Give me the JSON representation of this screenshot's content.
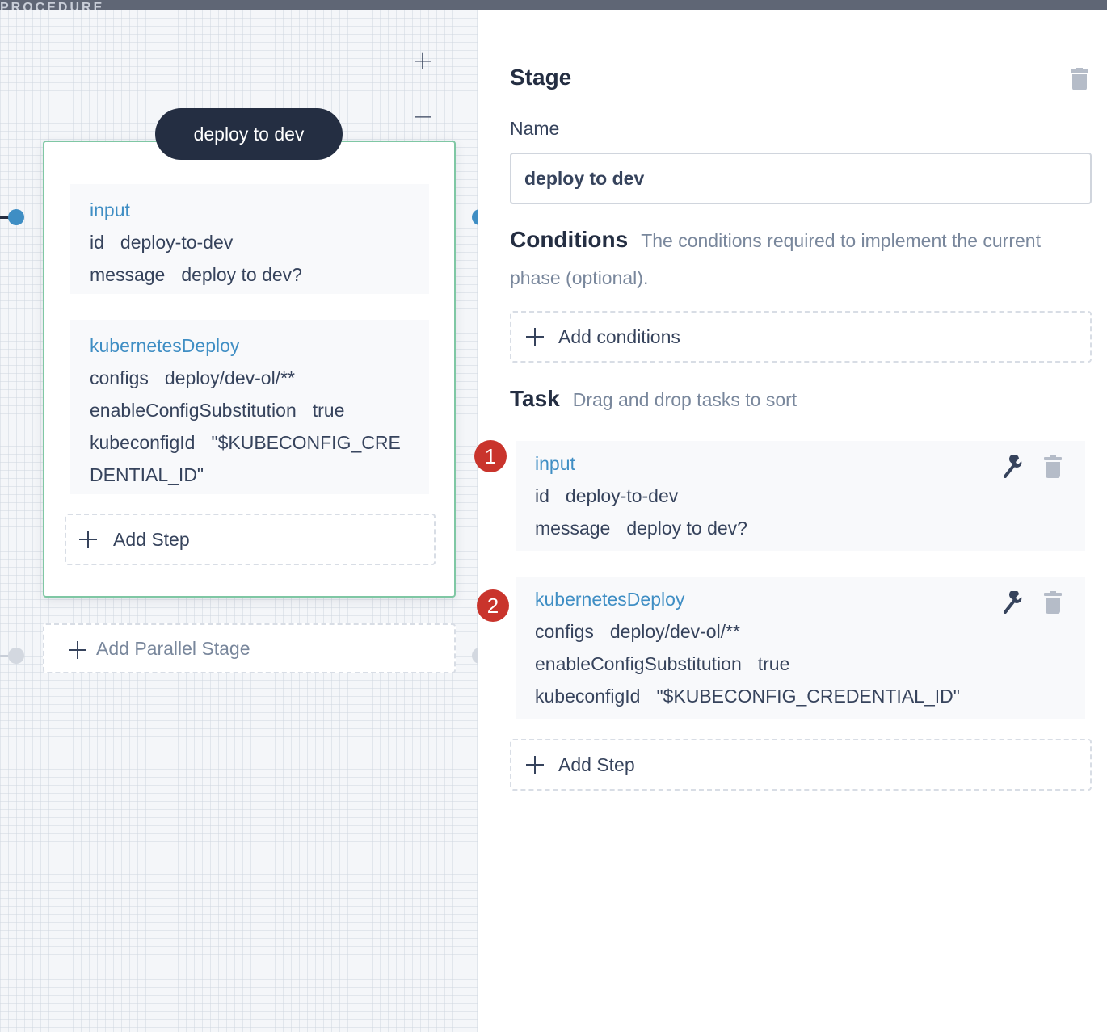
{
  "topbar": {
    "partial_text": "PROCEDURE"
  },
  "canvas": {
    "zoom_in": "+",
    "zoom_out": "−",
    "stage": {
      "title": "deploy to dev",
      "steps": [
        {
          "name": "input",
          "rows": [
            {
              "key": "id",
              "value": "deploy-to-dev"
            },
            {
              "key": "message",
              "value": "deploy to dev?"
            }
          ]
        },
        {
          "name": "kubernetesDeploy",
          "rows": [
            {
              "key": "configs",
              "value": "deploy/dev-ol/**"
            },
            {
              "key": "enableConfigSubstitution",
              "value": "true"
            },
            {
              "key": "kubeconfigId",
              "value": "\"$KUBECONFIG_CREDENTIAL_ID\""
            }
          ]
        }
      ],
      "add_step": "Add Step"
    },
    "add_parallel_stage": "Add Parallel Stage"
  },
  "panel": {
    "title": "Stage",
    "name_label": "Name",
    "name_value": "deploy to dev",
    "conditions_title": "Conditions",
    "conditions_desc": "The conditions required to implement the current phase (optional).",
    "add_conditions": "Add conditions",
    "task_title": "Task",
    "task_desc": "Drag and drop tasks to sort",
    "tasks": [
      {
        "badge": "1",
        "name": "input",
        "rows": [
          {
            "key": "id",
            "value": "deploy-to-dev"
          },
          {
            "key": "message",
            "value": "deploy to dev?"
          }
        ]
      },
      {
        "badge": "2",
        "name": "kubernetesDeploy",
        "rows": [
          {
            "key": "configs",
            "value": "deploy/dev-ol/**"
          },
          {
            "key": "enableConfigSubstitution",
            "value": "true"
          },
          {
            "key": "kubeconfigId",
            "value": "\"$KUBECONFIG_CREDENTIAL_ID\""
          }
        ]
      }
    ],
    "add_step": "Add Step"
  },
  "colors": {
    "accent_blue": "#3f8ec4",
    "dark": "#242e42",
    "stage_border_green": "#7fc7a4",
    "badge_red": "#c9342c"
  },
  "icons": [
    "plus-icon",
    "minus-icon",
    "trash-icon",
    "wrench-icon"
  ]
}
